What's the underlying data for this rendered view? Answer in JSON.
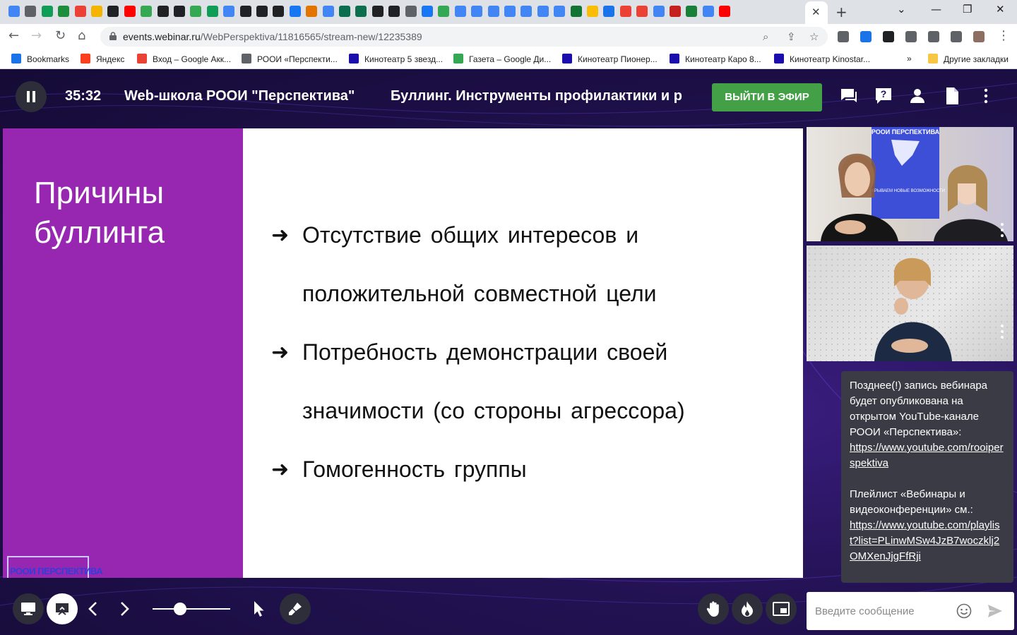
{
  "browser": {
    "tab_favicon_colors": [
      "#4285f4",
      "#5f6368",
      "#0f9d58",
      "#1e8e3e",
      "#ea4335",
      "#f4b400",
      "#202124",
      "#ff0000",
      "#34a853",
      "#202124",
      "#202124",
      "#34a853",
      "#0f9d58",
      "#4285f4",
      "#202124",
      "#202124",
      "#202124",
      "#1877f2",
      "#e37400",
      "#4285f4",
      "#0b6e4f",
      "#0b6e4f",
      "#202124",
      "#202124",
      "#5f6368",
      "#1877f2",
      "#34a853",
      "#4285f4",
      "#4285f4",
      "#4285f4",
      "#4285f4",
      "#4285f4",
      "#4285f4",
      "#4285f4",
      "#137333",
      "#fbbc04",
      "#1a73e8",
      "#ea4335",
      "#ea4335",
      "#4285f4",
      "#c5221f",
      "#188038",
      "#4285f4",
      "#ff0000"
    ],
    "active_tab_close": "✕",
    "new_tab": "+",
    "window_controls": {
      "minimize": "—",
      "maximize": "❐",
      "close": "✕",
      "dropdown": "⌄"
    },
    "nav": {
      "back": "←",
      "forward": "→",
      "reload": "↻",
      "home": "⌂"
    },
    "url": {
      "host": "events.webinar.ru",
      "path": "/WebPerspektiva/11816565/stream-new/12235389"
    },
    "omnibox_icons": [
      "zoom-icon",
      "share-icon",
      "star-icon"
    ],
    "extension_colors": [
      "#5f6368",
      "#1a73e8",
      "#202124",
      "#5f6368",
      "#5f6368",
      "#5f6368",
      "#8d6e63"
    ],
    "bookmarks": [
      {
        "label": "Bookmarks",
        "color": "#1a73e8"
      },
      {
        "label": "Яндекс",
        "color": "#fc3f1d"
      },
      {
        "label": "Вход – Google Акк...",
        "color": "#ea4335"
      },
      {
        "label": "РООИ «Перспекти...",
        "color": "#5f6368"
      },
      {
        "label": "Кинотеатр 5 звезд...",
        "color": "#1a0dab"
      },
      {
        "label": "Газета – Google Ди...",
        "color": "#34a853"
      },
      {
        "label": "Кинотеатр Пионер...",
        "color": "#1a0dab"
      },
      {
        "label": "Кинотеатр Каро 8...",
        "color": "#1a0dab"
      },
      {
        "label": "Кинотеатр Kinostar...",
        "color": "#1a0dab"
      }
    ],
    "bookmarks_overflow": "»",
    "other_bookmarks": "Другие закладки"
  },
  "header": {
    "timer": "35:32",
    "title": "Web-школа РООИ \"Перспектива\"",
    "subtitle": "Буллинг. Инструменты профилактики и р",
    "exit_button": "ВЫЙТИ В ЭФИР",
    "accent_color": "#43a047"
  },
  "slide": {
    "title": "Причины буллинга",
    "sidebar_color": "#9727b0",
    "bullet_arrow": "➜",
    "bullet_lines": [
      {
        "text": "Отсутствие общих интересов и",
        "arrow": true
      },
      {
        "text": "положительной совместной цели",
        "arrow": false
      },
      {
        "text": "Потребность демонстрации своей",
        "arrow": true
      },
      {
        "text": "значимости (со стороны агрессора)",
        "arrow": false
      },
      {
        "text": "Гомогенность группы",
        "arrow": true
      }
    ],
    "logo_text": "РООИ ПЕРСПЕКТИВА"
  },
  "videos": {
    "tile1_banner": "РООИ ПЕРСПЕКТИВА",
    "tile1_banner_sub": "ОТКРЫВАЕМ НОВЫЕ ВОЗМОЖНОСТИ"
  },
  "chat": {
    "message_p1": "Позднее(!) запись вебинара будет опубликована на открытом YouTube-канале РООИ «Перспектива»:",
    "link1": "https://www.youtube.com/rooiperspektiva",
    "message_p2": "Плейлист «Вебинары и видеоконференции» см.:",
    "link2": "https://www.youtube.com/playlist?list=PLinwMSw4JzB7woczklj2OMXenJjgFfRji",
    "input_placeholder": "Введите сообщение",
    "zoom_level": 0.35
  }
}
